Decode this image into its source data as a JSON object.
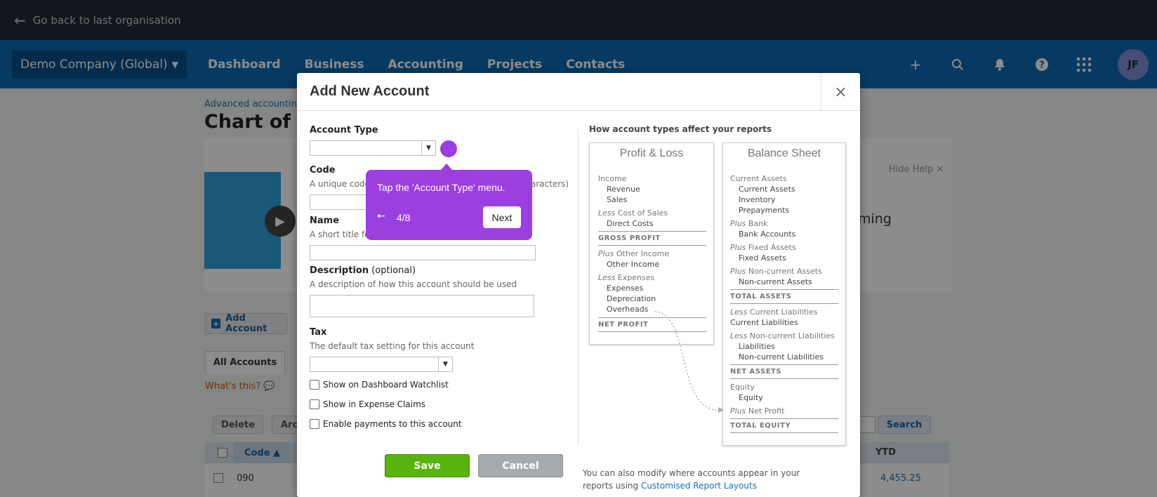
{
  "topbar": {
    "back_label": "Go back to last organisation"
  },
  "nav": {
    "org": "Demo Company (Global)",
    "items": [
      "Dashboard",
      "Business",
      "Accounting",
      "Projects",
      "Contacts"
    ],
    "avatar_initials": "JF",
    "icons": [
      "plus-icon",
      "search-icon",
      "bell-icon",
      "help-icon",
      "apps-grid-icon"
    ]
  },
  "page": {
    "breadcrumb": "Advanced accounting ›",
    "title": "Chart of ac",
    "hide_help": "Hide Help",
    "help_text_fragment": "ming",
    "add_account": "Add Account",
    "tab_all": "All Accounts",
    "whats_this": "What's this?",
    "delete": "Delete",
    "archive_fragment": "Arc",
    "search": "Search",
    "col_code": "Code ▲",
    "col_ytd": "YTD",
    "row_code": "090",
    "row_ytd": "4,455.25"
  },
  "modal": {
    "title": "Add New Account",
    "account_type_label": "Account Type",
    "code_label": "Code",
    "code_hint": "A unique code",
    "code_hint_tail": "aracters)",
    "name_label": "Name",
    "name_hint": "A short title fo",
    "description_label": "Description",
    "description_optional": " (optional)",
    "description_hint": "A description of how this account should be used",
    "tax_label": "Tax",
    "tax_hint": "The default tax setting for this account",
    "checkbox_watchlist": "Show on Dashboard Watchlist",
    "checkbox_expense": "Show in Expense Claims",
    "checkbox_payments": "Enable payments to this account",
    "save": "Save",
    "cancel": "Cancel",
    "reports_heading": "How account types affect your reports",
    "pl": {
      "title": "Profit & Loss",
      "income": "Income",
      "revenue": "Revenue",
      "sales": "Sales",
      "less1": "Less",
      "cost_of_sales": " Cost of Sales",
      "direct_costs": "Direct Costs",
      "gross_profit": "GROSS PROFIT",
      "plus1": "Plus",
      "other_income_head": " Other Income",
      "other_income": "Other Income",
      "less2": "Less",
      "expenses_head": " Expenses",
      "expenses": "Expenses",
      "depreciation": "Depreciation",
      "overheads": "Overheads",
      "net_profit": "NET PROFIT"
    },
    "bs": {
      "title": "Balance Sheet",
      "current_assets_head": "Current Assets",
      "current_assets": "Current Assets",
      "inventory": "Inventory",
      "prepayments": "Prepayments",
      "plus_bank_p": "Plus",
      "plus_bank": " Bank",
      "bank_accounts": "Bank Accounts",
      "plus_fixed_p": "Plus",
      "plus_fixed": " Fixed Assets",
      "fixed_assets": "Fixed Assets",
      "plus_noncur_p": "Plus",
      "plus_noncur": " Non-current Assets",
      "noncurrent_assets": "Non-current Assets",
      "total_assets": "TOTAL ASSETS",
      "less_cur_p": "Less",
      "less_cur": " Current Liabilities",
      "current_liabilities": "Current Liabilities",
      "less_noncur_p": "Less",
      "less_noncur": " Non-current Liabilities",
      "liabilities": "Liabilities",
      "noncurrent_liabilities": "Non-current Liabilities",
      "net_assets": "NET ASSETS",
      "equity_head": "Equity",
      "equity": "Equity",
      "plus_np_p": "Plus",
      "plus_np": " Net Profit",
      "total_equity": "TOTAL EQUITY"
    },
    "footnote": "You can also modify where accounts appear in your reports using ",
    "footnote_link": "Customised Report Layouts"
  },
  "tooltip": {
    "text": "Tap the 'Account Type' menu.",
    "step": "4/8",
    "next": "Next"
  },
  "colors": {
    "nav": "#0b6bb5",
    "topbar": "#1f2a35",
    "tooltip": "#9c3fe0",
    "save": "#5ab30c"
  }
}
